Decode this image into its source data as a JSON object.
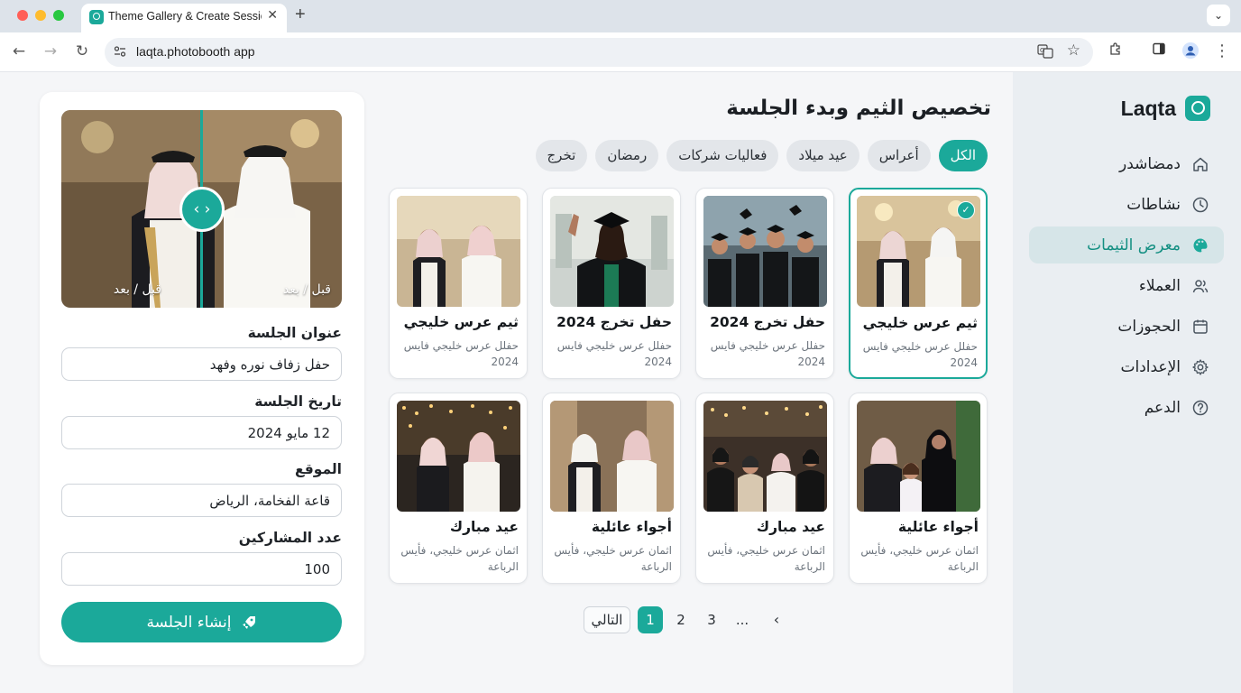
{
  "browser": {
    "tab_title": "Theme Gallery & Create Session",
    "url": "laqta.photobooth app"
  },
  "brand": {
    "name": "Laqta",
    "accent": "#1ba99a"
  },
  "sidebar": {
    "items": [
      {
        "label": "دمضاشدر",
        "icon": "home-icon"
      },
      {
        "label": "نشاطات",
        "icon": "clock-icon"
      },
      {
        "label": "معرض الثيمات",
        "icon": "palette-icon",
        "active": true
      },
      {
        "label": "العملاء",
        "icon": "users-icon"
      },
      {
        "label": "الحجوزات",
        "icon": "calendar-icon"
      },
      {
        "label": "الإعدادات",
        "icon": "gear-icon"
      },
      {
        "label": "الدعم",
        "icon": "help-icon"
      }
    ]
  },
  "main": {
    "title": "تخصيص الثيم وبدء الجلسة",
    "filters": [
      "الكل",
      "أعراس",
      "عيد ميلاد",
      "فعاليات شركات",
      "رمضان",
      "تخرج"
    ],
    "active_filter": "الكل",
    "themes": [
      {
        "title": "ثيم عرس خليجي",
        "desc": "حفلل عرس خليجي فايس 2024",
        "selected": true
      },
      {
        "title": "حفل تخرج 2024",
        "desc": "حفلل عرس خليجي فايس 2024"
      },
      {
        "title": "حفل تخرج 2024",
        "desc": "حفلل عرس خليجي فايس 2024"
      },
      {
        "title": "ثيم عرس خليجي",
        "desc": "حفلل عرس خليجي فايس 2024"
      },
      {
        "title": "أجواء عائلية",
        "desc": "اثمان عرس خليجي، فأيس الرباعة"
      },
      {
        "title": "عيد مبارك",
        "desc": "اثمان عرس خليجي، فأيس الرباعة"
      },
      {
        "title": "أجواء عائلية",
        "desc": "اثمان عرس خليجي، فأيس الرباعة"
      },
      {
        "title": "عيد مبارك",
        "desc": "اثمان عرس خليجي، فأيس الرباعة"
      }
    ],
    "pagination": {
      "next_label": "التالي",
      "pages": [
        "1",
        "2",
        "3"
      ],
      "ellipsis": "...",
      "current": 1
    }
  },
  "panel": {
    "compare_label": "قبل / بعد",
    "fields": [
      {
        "label": "عنوان الجلسة",
        "value": "حفل زفاف نوره وفهد"
      },
      {
        "label": "تاريخ الجلسة",
        "value": "12 مايو 2024"
      },
      {
        "label": "الموقع",
        "value": "قاعة الفخامة، الرياض"
      },
      {
        "label": "عدد المشاركين",
        "value": "100"
      }
    ],
    "create_button": "إنشاء الجلسة"
  }
}
